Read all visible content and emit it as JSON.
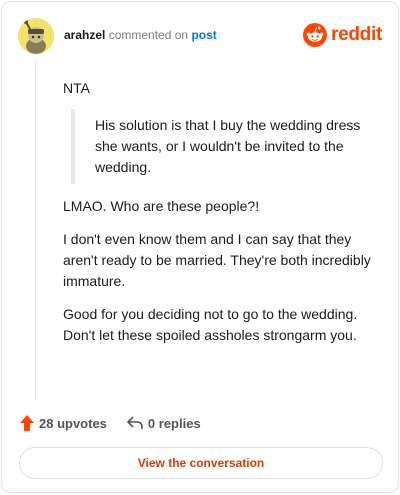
{
  "header": {
    "username": "arahzel",
    "action_text": "commented on",
    "target_link": "post",
    "brand": "reddit"
  },
  "comment": {
    "p1": "NTA",
    "quote": "His solution is that I buy the wedding dress she wants, or I wouldn't be invited to the wedding.",
    "p2": "LMAO. Who are these people?!",
    "p3": "I don't even know them and I can say that they aren't ready to be married. They're both incredibly immature.",
    "p4": "Good for you deciding not to go to the wedding. Don't let these spoiled assholes strongarm you."
  },
  "footer": {
    "upvotes_label": "28 upvotes",
    "replies_label": "0 replies",
    "cta_label": "View the conversation"
  },
  "colors": {
    "brand": "#ff4500",
    "link": "#0079d3",
    "avatar_bg": "#f1e36b"
  },
  "icons": [
    "avatar-icon",
    "reddit-logo-icon",
    "upvote-arrow-icon",
    "reply-icon"
  ]
}
